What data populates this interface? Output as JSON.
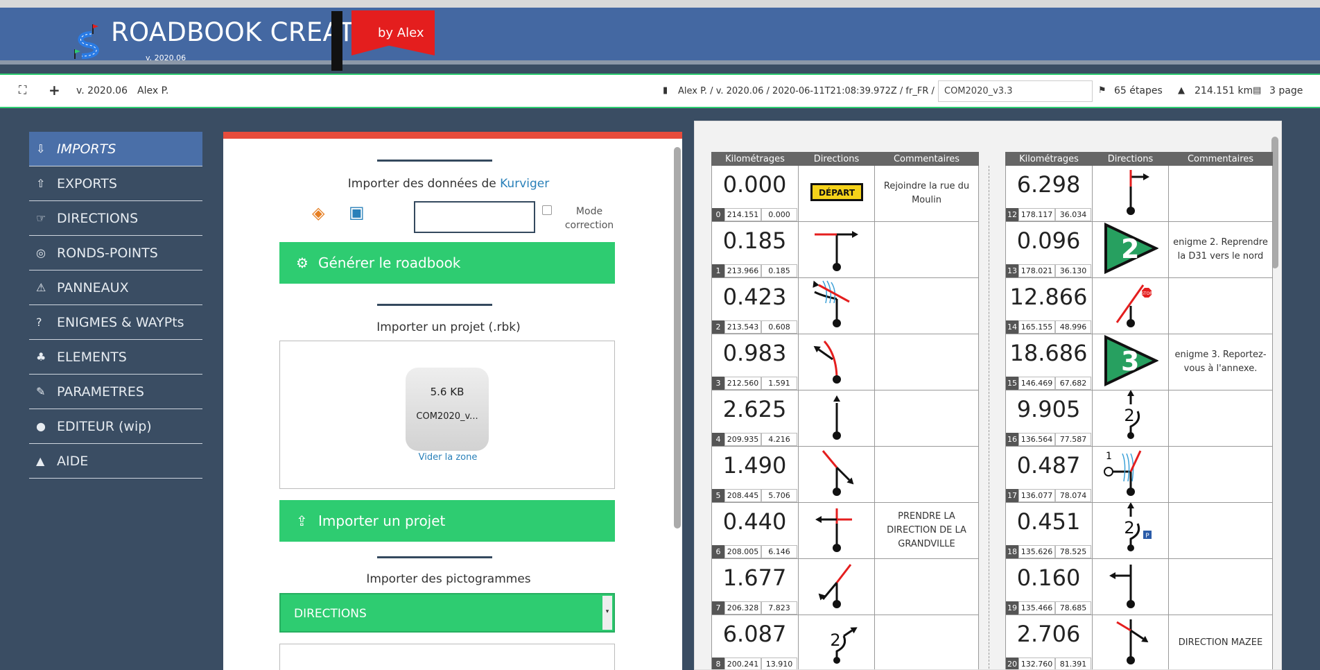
{
  "header": {
    "title": "ROADBOOK CREATOR",
    "version": "v. 2020.06",
    "by": "by Alex"
  },
  "toolbar": {
    "version": "v. 2020.06",
    "user": "Alex P.",
    "path": "Alex P. / v. 2020.06 / 2020-06-11T21:08:39.972Z / fr_FR /",
    "project": "COM2020_v3.3",
    "steps": "65 étapes",
    "distance": "214.151 km",
    "pages": "3 page"
  },
  "sidebar": {
    "items": [
      {
        "label": "IMPORTS",
        "icon": "import-icon"
      },
      {
        "label": "EXPORTS",
        "icon": "export-icon"
      },
      {
        "label": "DIRECTIONS",
        "icon": "hand-pointer-icon"
      },
      {
        "label": "RONDS-POINTS",
        "icon": "roundabout-icon"
      },
      {
        "label": "PANNEAUX",
        "icon": "warning-sign-icon"
      },
      {
        "label": "ENIGMES & WAYPts",
        "icon": "question-icon"
      },
      {
        "label": "ELEMENTS",
        "icon": "tree-icon"
      },
      {
        "label": "PARAMETRES",
        "icon": "wrench-icon"
      },
      {
        "label": "EDITEUR (wip)",
        "icon": "user-icon"
      },
      {
        "label": "AIDE",
        "icon": "graduation-cap-icon"
      }
    ]
  },
  "imports": {
    "kurviger_prefix": "Importer des données de ",
    "kurviger_link": "Kurviger",
    "mode_correction": "Mode correction",
    "generate_button": "Générer le roadbook",
    "project_title": "Importer un projet (.rbk)",
    "file_size": "5.6 KB",
    "file_name": "COM2020_v...",
    "clear_zone": "Vider la zone",
    "import_button": "Importer un projet",
    "pictos_title": "Importer des pictogrammes",
    "pictos_select": "DIRECTIONS"
  },
  "roadbook": {
    "headers": [
      "Kilométrages",
      "Directions",
      "Commentaires"
    ],
    "left": [
      {
        "idx": "0",
        "partial": "0.000",
        "total": "214.151",
        "cumul": "0.000",
        "dir": "depart",
        "comment": "Rejoindre la rue du Moulin"
      },
      {
        "idx": "1",
        "partial": "0.185",
        "total": "213.966",
        "cumul": "0.185",
        "dir": "t-right",
        "comment": ""
      },
      {
        "idx": "2",
        "partial": "0.423",
        "total": "213.543",
        "cumul": "0.608",
        "dir": "river-left",
        "comment": ""
      },
      {
        "idx": "3",
        "partial": "0.983",
        "total": "212.560",
        "cumul": "1.591",
        "dir": "curve-left",
        "comment": ""
      },
      {
        "idx": "4",
        "partial": "2.625",
        "total": "209.935",
        "cumul": "4.216",
        "dir": "straight",
        "comment": ""
      },
      {
        "idx": "5",
        "partial": "1.490",
        "total": "208.445",
        "cumul": "5.706",
        "dir": "diag-right",
        "comment": ""
      },
      {
        "idx": "6",
        "partial": "0.440",
        "total": "208.005",
        "cumul": "6.146",
        "dir": "cross-left",
        "comment": "PRENDRE LA DIRECTION DE LA GRANDVILLE"
      },
      {
        "idx": "7",
        "partial": "1.677",
        "total": "206.328",
        "cumul": "7.823",
        "dir": "diag-left",
        "comment": ""
      },
      {
        "idx": "8",
        "partial": "6.087",
        "total": "200.241",
        "cumul": "13.910",
        "dir": "round2",
        "comment": ""
      }
    ],
    "right": [
      {
        "idx": "12",
        "partial": "6.298",
        "total": "178.117",
        "cumul": "36.034",
        "dir": "straight-flag",
        "comment": ""
      },
      {
        "idx": "13",
        "partial": "0.096",
        "total": "178.021",
        "cumul": "36.130",
        "dir": "enigme2",
        "comment": "enigme 2. Reprendre la D31 vers le nord"
      },
      {
        "idx": "14",
        "partial": "12.866",
        "total": "165.155",
        "cumul": "48.996",
        "dir": "stop-right",
        "comment": ""
      },
      {
        "idx": "15",
        "partial": "18.686",
        "total": "146.469",
        "cumul": "67.682",
        "dir": "enigme3",
        "comment": "enigme 3. Reportez-vous à l'annexe."
      },
      {
        "idx": "16",
        "partial": "9.905",
        "total": "136.564",
        "cumul": "77.587",
        "dir": "round2b",
        "comment": ""
      },
      {
        "idx": "17",
        "partial": "0.487",
        "total": "136.077",
        "cumul": "78.074",
        "dir": "river-right",
        "comment": ""
      },
      {
        "idx": "18",
        "partial": "0.451",
        "total": "135.626",
        "cumul": "78.525",
        "dir": "round2p",
        "comment": ""
      },
      {
        "idx": "19",
        "partial": "0.160",
        "total": "135.466",
        "cumul": "78.685",
        "dir": "t-left",
        "comment": ""
      },
      {
        "idx": "20",
        "partial": "2.706",
        "total": "132.760",
        "cumul": "81.391",
        "dir": "cross-right",
        "comment": "DIRECTION MAZEE"
      }
    ]
  }
}
